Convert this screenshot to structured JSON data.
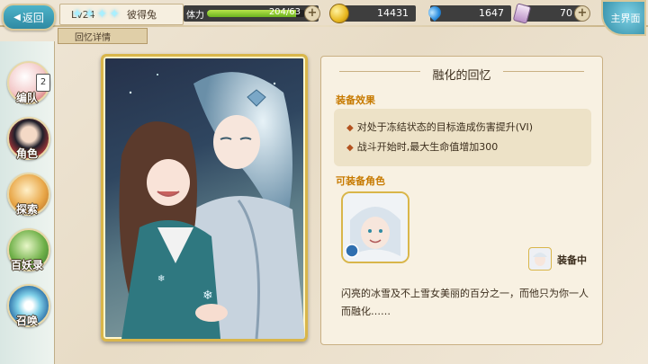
{
  "topbar": {
    "back_label": "返回",
    "level": "Lv24",
    "player_name": "彼得兔",
    "stamina_label": "体力",
    "stamina_value": "204/63",
    "stamina_fill": 0.9,
    "gold": "14431",
    "water": "1647",
    "cards": "70",
    "main_label": "主界面",
    "plus": "+"
  },
  "subtab": {
    "label": "回忆详情"
  },
  "sidebar": {
    "items": [
      {
        "label": "编队",
        "icon": "team-icon",
        "badge": "2"
      },
      {
        "label": "角色",
        "icon": "character-icon"
      },
      {
        "label": "探索",
        "icon": "explore-icon"
      },
      {
        "label": "百妖录",
        "icon": "book-icon"
      },
      {
        "label": "召唤",
        "icon": "summon-icon"
      }
    ]
  },
  "card": {
    "stars": "✦✦✦✦"
  },
  "detail": {
    "title": "融化的回忆",
    "effect_heading": "装备效果",
    "effects": [
      "对处于冻结状态的目标造成伤害提升(VI)",
      "战斗开始时,最大生命值增加300"
    ],
    "equippable_heading": "可装备角色",
    "equipped_status": "装备中",
    "flavor": "闪亮的冰雪及不上雪女美丽的百分之一，而他只为你一人而融化……"
  },
  "colors": {
    "accent": "#c77a00",
    "frame_gold": "#d9b64a",
    "panel_bg": "#f8f1e2"
  }
}
